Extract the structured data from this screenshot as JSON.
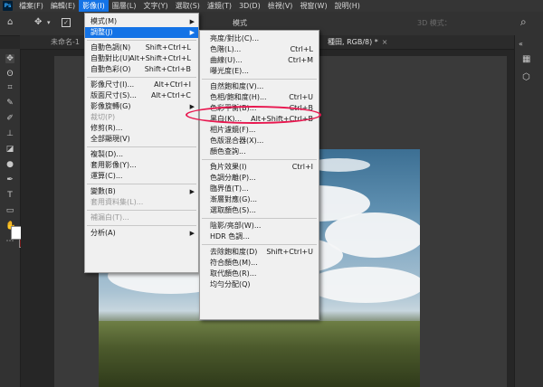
{
  "menubar": {
    "logo": "Ps",
    "items": [
      "檔案(F)",
      "編輯(E)",
      "影像(I)",
      "圖層(L)",
      "文字(Y)",
      "選取(S)",
      "濾鏡(T)",
      "3D(D)",
      "檢視(V)",
      "視窗(W)",
      "說明(H)"
    ],
    "active_index": 2
  },
  "options_bar": {
    "mode_text": "模式",
    "mode_3d": "3D 模式：",
    "icons": [
      "home-icon",
      "move-icon",
      "chevron-down-icon",
      "checkbox-icon"
    ]
  },
  "tabs": {
    "left_tab": "未命名-1",
    "right_tab": "種田, RGB/8) *",
    "close_glyph": "×"
  },
  "image_menu": {
    "items": [
      {
        "label": "模式(M)",
        "shortcut": "",
        "submenu": true,
        "disabled": false
      },
      {
        "label": "調整(J)",
        "shortcut": "",
        "submenu": true,
        "disabled": false,
        "highlight": true
      },
      {
        "sep": true
      },
      {
        "label": "自動色調(N)",
        "shortcut": "Shift+Ctrl+L",
        "disabled": false
      },
      {
        "label": "自動對比(U)",
        "shortcut": "Alt+Shift+Ctrl+L",
        "disabled": false
      },
      {
        "label": "自動色彩(O)",
        "shortcut": "Shift+Ctrl+B",
        "disabled": false
      },
      {
        "sep": true
      },
      {
        "label": "影像尺寸(I)...",
        "shortcut": "Alt+Ctrl+I",
        "disabled": false
      },
      {
        "label": "版面尺寸(S)...",
        "shortcut": "Alt+Ctrl+C",
        "disabled": false
      },
      {
        "label": "影像旋轉(G)",
        "shortcut": "",
        "submenu": true,
        "disabled": false
      },
      {
        "label": "裁切(P)",
        "shortcut": "",
        "disabled": true
      },
      {
        "label": "修剪(R)...",
        "shortcut": "",
        "disabled": false
      },
      {
        "label": "全部顯現(V)",
        "shortcut": "",
        "disabled": false
      },
      {
        "sep": true
      },
      {
        "label": "複製(D)...",
        "shortcut": "",
        "disabled": false
      },
      {
        "label": "套用影像(Y)...",
        "shortcut": "",
        "disabled": false
      },
      {
        "label": "運算(C)...",
        "shortcut": "",
        "disabled": false
      },
      {
        "sep": true
      },
      {
        "label": "變數(B)",
        "shortcut": "",
        "submenu": true,
        "disabled": false
      },
      {
        "label": "套用資料集(L)...",
        "shortcut": "",
        "disabled": true
      },
      {
        "sep": true
      },
      {
        "label": "補漏白(T)...",
        "shortcut": "",
        "disabled": true
      },
      {
        "sep": true
      },
      {
        "label": "分析(A)",
        "shortcut": "",
        "submenu": true,
        "disabled": false
      }
    ]
  },
  "adjust_menu": {
    "items": [
      {
        "label": "亮度/對比(C)...",
        "shortcut": ""
      },
      {
        "label": "色階(L)...",
        "shortcut": "Ctrl+L"
      },
      {
        "label": "曲線(U)...",
        "shortcut": "Ctrl+M"
      },
      {
        "label": "曝光度(E)...",
        "shortcut": ""
      },
      {
        "sep": true
      },
      {
        "label": "自然飽和度(V)...",
        "shortcut": ""
      },
      {
        "label": "色相/飽和度(H)...",
        "shortcut": "Ctrl+U"
      },
      {
        "label": "色彩平衡(B)...",
        "shortcut": "Ctrl+B",
        "circled": true
      },
      {
        "label": "黑白(K)...",
        "shortcut": "Alt+Shift+Ctrl+B"
      },
      {
        "label": "相片濾鏡(F)...",
        "shortcut": ""
      },
      {
        "label": "色版混合器(X)...",
        "shortcut": ""
      },
      {
        "label": "顏色查詢...",
        "shortcut": ""
      },
      {
        "sep": true
      },
      {
        "label": "負片效果(I)",
        "shortcut": "Ctrl+I"
      },
      {
        "label": "色調分離(P)...",
        "shortcut": ""
      },
      {
        "label": "臨界值(T)...",
        "shortcut": ""
      },
      {
        "label": "漸層對應(G)...",
        "shortcut": ""
      },
      {
        "label": "選取顏色(S)...",
        "shortcut": ""
      },
      {
        "sep": true
      },
      {
        "label": "陰影/亮部(W)...",
        "shortcut": ""
      },
      {
        "label": "HDR 色調...",
        "shortcut": ""
      },
      {
        "sep": true
      },
      {
        "label": "去除飽和度(D)",
        "shortcut": "Shift+Ctrl+U"
      },
      {
        "label": "符合顏色(M)...",
        "shortcut": ""
      },
      {
        "label": "取代顏色(R)...",
        "shortcut": ""
      },
      {
        "label": "均勻分配(Q)",
        "shortcut": ""
      }
    ]
  },
  "colors": {
    "accent": "#1473e6",
    "highlight_ring": "#e8174f",
    "foreground_swatch": "#ffffff",
    "background_swatch": "#7a1c1c"
  }
}
